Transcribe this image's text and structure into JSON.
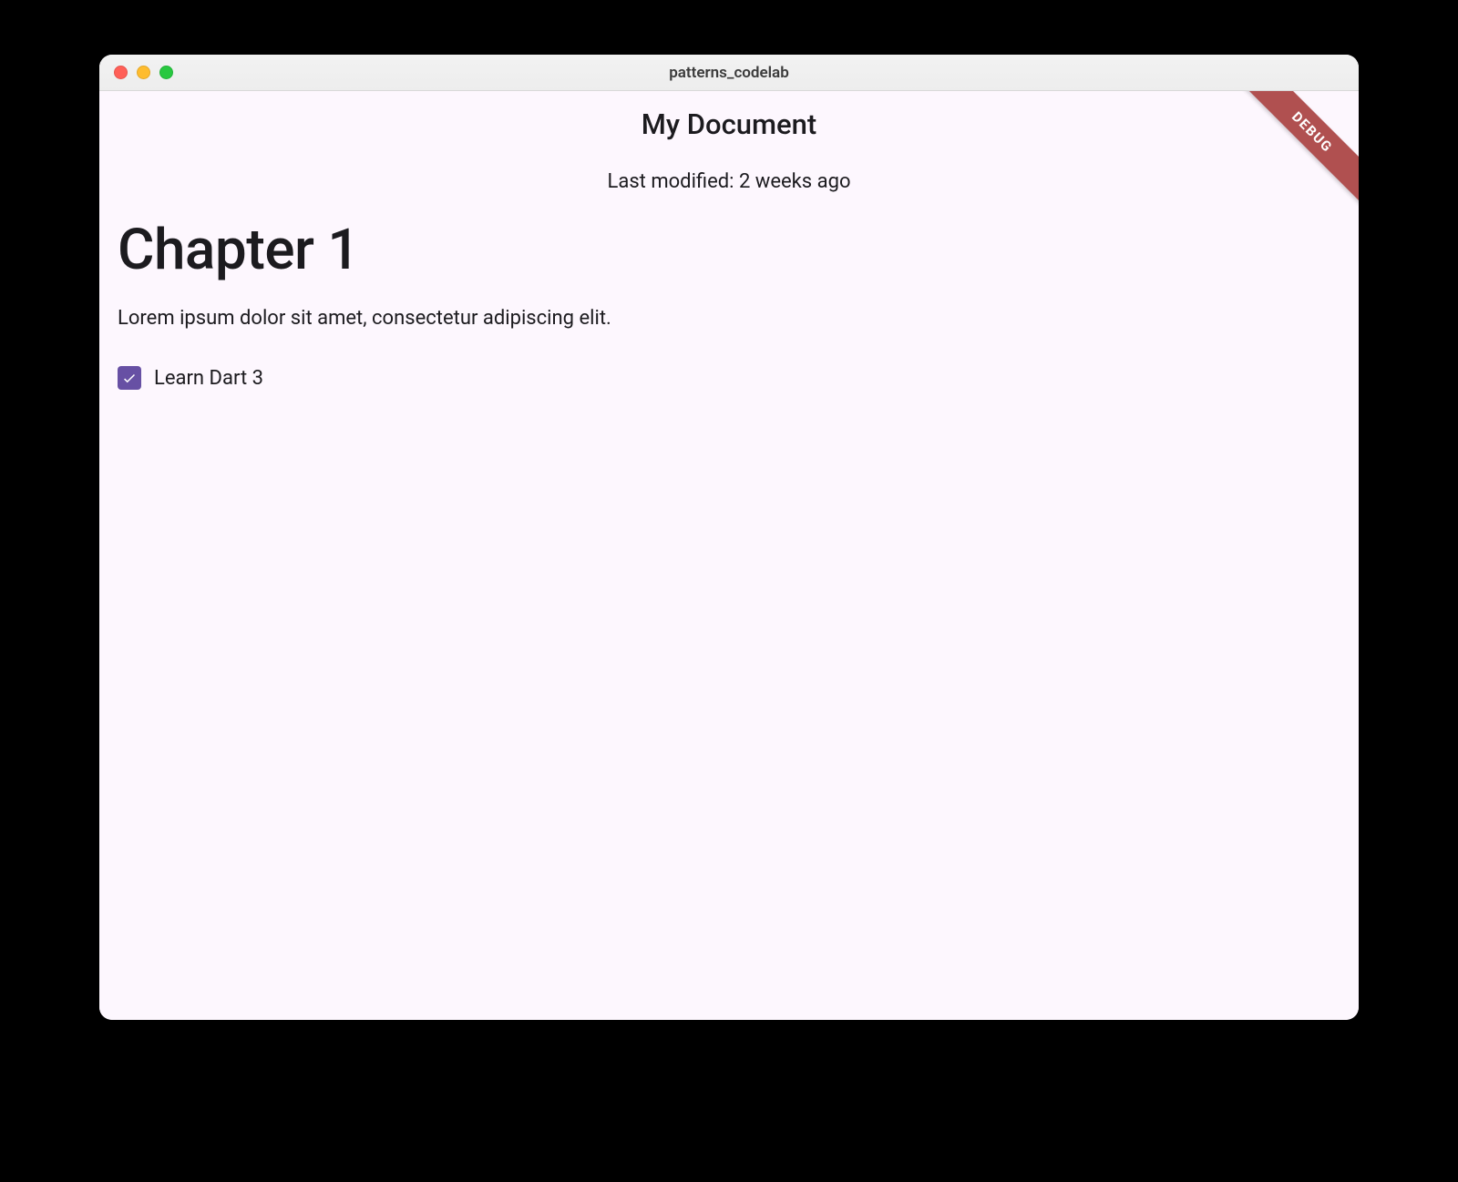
{
  "window": {
    "title": "patterns_codelab"
  },
  "header": {
    "title": "My Document",
    "last_modified": "Last modified: 2 weeks ago"
  },
  "content": {
    "heading": "Chapter 1",
    "paragraph": "Lorem ipsum dolor sit amet, consectetur adipiscing elit."
  },
  "todo": {
    "checked": true,
    "label": "Learn Dart 3"
  },
  "banner": {
    "text": "DEBUG"
  },
  "colors": {
    "checkbox_accent": "#6750a4",
    "body_bg": "#fdf7fe",
    "debug_ribbon": "#b05050"
  }
}
